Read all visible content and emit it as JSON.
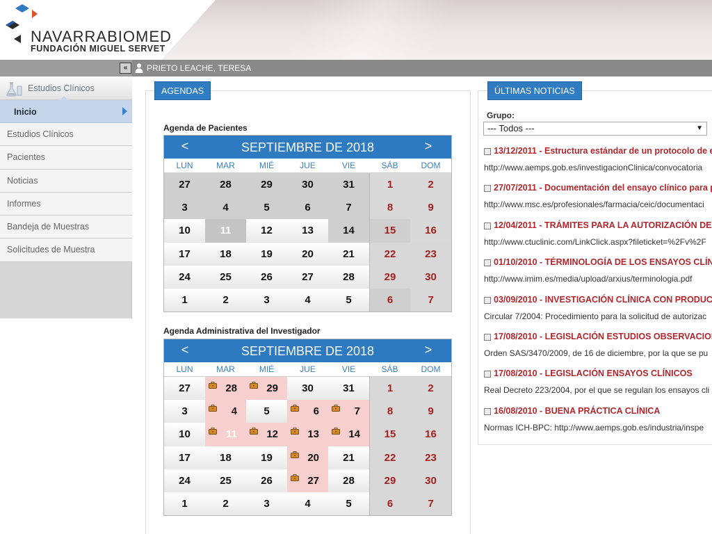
{
  "header": {
    "brand_name": "NAVARRABIOMED",
    "brand_sub": "FUNDACIÓN MIGUEL SERVET",
    "colors": {
      "blue": "#2f7cc2",
      "red": "#e0522b",
      "dark": "#333333"
    }
  },
  "userbar": {
    "collapse_glyph": "«",
    "user_name": "PRIETO LEACHE, TERESA"
  },
  "sidebar": {
    "module_title": "Estudios Clínicos",
    "active_item": "Inicio",
    "items": [
      {
        "label": "Estudios Clínicos"
      },
      {
        "label": "Pacientes"
      },
      {
        "label": "Noticias"
      },
      {
        "label": "Informes"
      },
      {
        "label": "Bandeja de Muestras"
      },
      {
        "label": "Solicitudes de Muestra"
      }
    ]
  },
  "agendas": {
    "tab_label": "AGENDAS",
    "weekdays": [
      "LUN",
      "MAR",
      "MIÉ",
      "JUE",
      "VIE",
      "SÁB",
      "DOM"
    ],
    "prev": "<",
    "next": ">",
    "patients": {
      "title": "Agenda de Pacientes",
      "month_label": "SEPTIEMBRE DE 2018",
      "weeks": [
        [
          27,
          28,
          29,
          30,
          31,
          1,
          2
        ],
        [
          3,
          4,
          5,
          6,
          7,
          8,
          9
        ],
        [
          10,
          11,
          12,
          13,
          14,
          15,
          16
        ],
        [
          17,
          18,
          19,
          20,
          21,
          22,
          23
        ],
        [
          24,
          25,
          26,
          27,
          28,
          29,
          30
        ],
        [
          1,
          2,
          3,
          4,
          5,
          6,
          7
        ]
      ],
      "styles": [
        [
          "g",
          "g",
          "g",
          "g",
          "g",
          "lg",
          "lg"
        ],
        [
          "g",
          "g",
          "g",
          "g",
          "g",
          "lg",
          "lg"
        ],
        [
          "w",
          "sel",
          "w",
          "w",
          "g",
          "g",
          "lg"
        ],
        [
          "w",
          "w",
          "w",
          "w",
          "w",
          "we",
          "we"
        ],
        [
          "w",
          "w",
          "w",
          "w",
          "w",
          "we",
          "we"
        ],
        [
          "w",
          "w",
          "w",
          "w",
          "w",
          "g",
          "we"
        ]
      ]
    },
    "investigator": {
      "title": "Agenda Administrativa del Investigador",
      "month_label": "SEPTIEMBRE DE 2018",
      "weeks": [
        [
          27,
          28,
          29,
          30,
          31,
          1,
          2
        ],
        [
          3,
          4,
          5,
          6,
          7,
          8,
          9
        ],
        [
          10,
          11,
          12,
          13,
          14,
          15,
          16
        ],
        [
          17,
          18,
          19,
          20,
          21,
          22,
          23
        ],
        [
          24,
          25,
          26,
          27,
          28,
          29,
          30
        ],
        [
          1,
          2,
          3,
          4,
          5,
          6,
          7
        ]
      ],
      "styles": [
        [
          "w",
          "ev",
          "ev",
          "w",
          "w",
          "we",
          "we"
        ],
        [
          "w",
          "ev",
          "w",
          "ev",
          "ev",
          "we",
          "we"
        ],
        [
          "w",
          "evsel",
          "ev",
          "ev",
          "ev",
          "we",
          "we"
        ],
        [
          "w",
          "w",
          "w",
          "ev",
          "w",
          "we",
          "we"
        ],
        [
          "w",
          "w",
          "w",
          "ev",
          "w",
          "we",
          "we"
        ],
        [
          "w",
          "w",
          "w",
          "w",
          "w",
          "we",
          "we"
        ]
      ]
    }
  },
  "news": {
    "tab_label": "ÚLTIMAS NOTICIAS",
    "group_label": "Grupo:",
    "group_selected": "--- Todos ---",
    "items": [
      {
        "title": "13/12/2011 - Estructura estándar de un protocolo de e",
        "desc": "http://www.aemps.gob.es/investigacionClinica/convocatoria"
      },
      {
        "title": "27/07/2011 - Documentación del ensayo clínico para p",
        "desc": "http://www.msc.es/profesionales/farmacia/ceic/documentaci"
      },
      {
        "title": "12/04/2011 - TRÁMITES PARA LA AUTORIZACIÓN DE",
        "desc": "http://www.ctuclinic.com/LinkClick.aspx?fileticket=%2Fv%2F"
      },
      {
        "title": "01/10/2010 - TÉRMINOLOGÍA DE LOS ENSAYOS CLÍN",
        "desc": "http://www.imim.es/media/upload/arxius/terminologia.pdf"
      },
      {
        "title": "03/09/2010 - INVESTIGACIÓN CLÍNICA CON PRODUC",
        "desc": "Circular 7/2004: Procedimiento para la solicitud de autorizac"
      },
      {
        "title": "17/08/2010 - LEGISLACIÓN ESTUDIOS OBSERVACION",
        "desc": "Orden SAS/3470/2009, de 16 de diciembre, por la que se pu"
      },
      {
        "title": "17/08/2010 - LEGISLACIÓN ENSAYOS CLÍNICOS",
        "desc": "Real Decreto 223/2004, por el que se regulan los ensayos cli"
      },
      {
        "title": "16/08/2010 - BUENA PRÁCTICA CLÍNICA",
        "desc": "Normas ICH-BPC: http://www.aemps.gob.es/industria/inspe"
      }
    ]
  },
  "icons": {
    "logo": "navarrabiomed-logo-icon",
    "user": "user-icon",
    "flask": "flask-icon",
    "event": "briefcase-icon",
    "checkbox": "news-bullet-icon"
  }
}
